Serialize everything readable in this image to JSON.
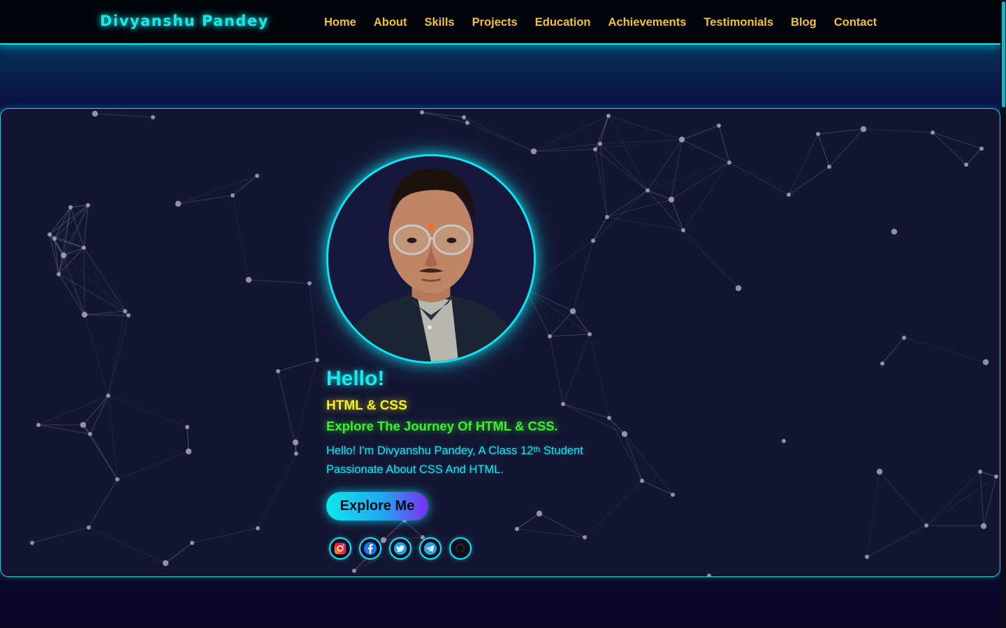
{
  "site": {
    "brand": "Divyanshu Pandey"
  },
  "nav": {
    "items": [
      "Home",
      "About",
      "Skills",
      "Projects",
      "Education",
      "Achievements",
      "Testimonials",
      "Blog",
      "Contact"
    ]
  },
  "hero": {
    "greeting": "Hello!",
    "subtitle": "HTML & CSS",
    "tagline": "Explore The Journey Of HTML & CSS.",
    "bio_part1": "Hello! I'm Divyanshu Pandey, A Class 12",
    "bio_sup": "th",
    "bio_part2": " Student Passionate About CSS And HTML.",
    "cta_label": "Explore Me",
    "socials": [
      "instagram-icon",
      "facebook-icon",
      "twitter-icon",
      "telegram-icon",
      "github-icon"
    ]
  },
  "colors": {
    "accent_cyan": "#12e3f2",
    "nav_link": "#f0c23a",
    "subtitle_yellow": "#f4f12a",
    "tagline_green": "#3df030",
    "card_bg": "#141532"
  }
}
